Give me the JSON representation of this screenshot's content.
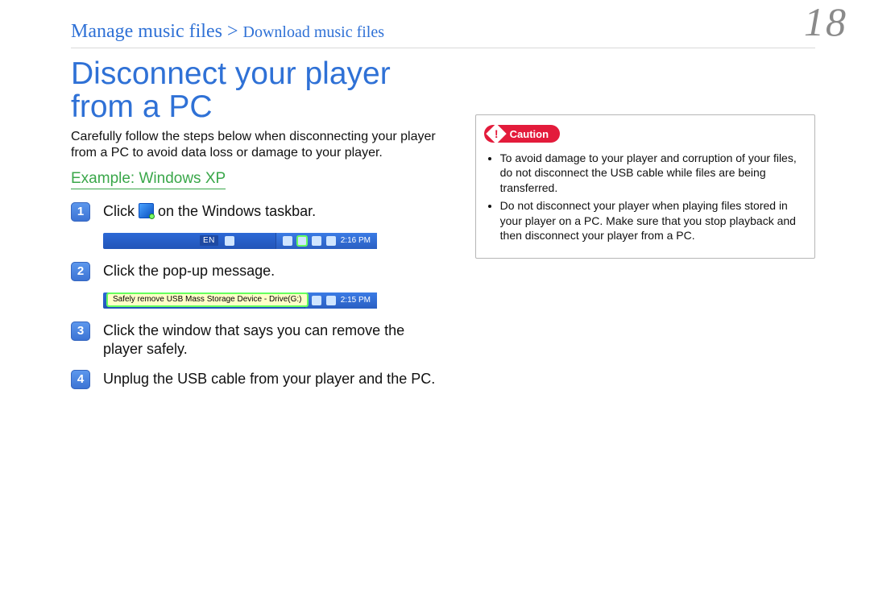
{
  "page_number": "18",
  "breadcrumb": {
    "main": "Manage music files",
    "sep": " > ",
    "sub": "Download music files"
  },
  "title": "Disconnect your player from a PC",
  "intro": "Carefully follow the steps below when disconnecting your player from a PC to avoid data loss or damage to your player.",
  "example_label": "Example: Windows XP",
  "steps": {
    "s1a": "Click ",
    "s1b": " on the Windows taskbar.",
    "s2": "Click the pop-up message.",
    "s3": "Click the window that says you can remove the player safely.",
    "s4": "Unplug the USB cable from your player and the PC."
  },
  "taskbar1": {
    "lang": "EN",
    "time": "2:16 PM"
  },
  "taskbar2": {
    "bubble": "Safely remove USB Mass Storage Device - Drive(G:)",
    "time": "2:15 PM"
  },
  "caution": {
    "label": "Caution",
    "items": [
      "To avoid damage to your player and corruption of your files, do not disconnect the USB cable while files are being transferred.",
      "Do not disconnect your player when playing files stored in your player on a PC. Make sure that you stop playback and then disconnect your player from a PC."
    ]
  }
}
